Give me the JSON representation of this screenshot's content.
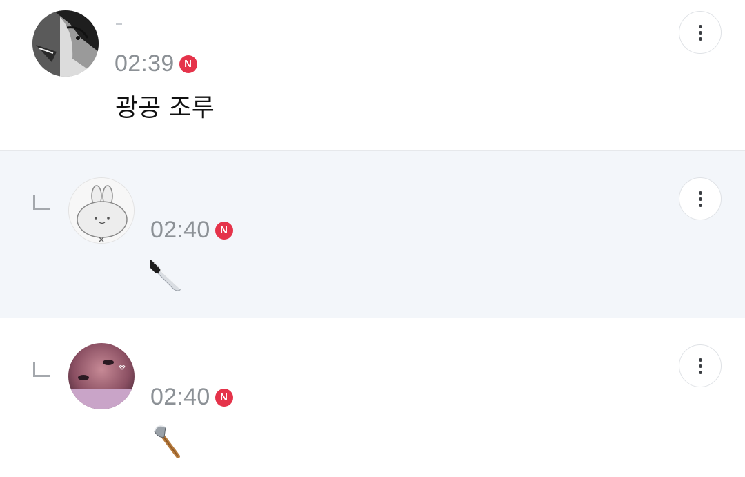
{
  "comments": [
    {
      "author_avatar": "manga-portrait-avatar",
      "time": "02:39",
      "new_badge": "N",
      "body": "광공 조루",
      "is_reply": false
    },
    {
      "author_avatar": "bunny-avatar",
      "time": "02:40",
      "new_badge": "N",
      "body_icon": "kitchen-knife-icon",
      "is_reply": true
    },
    {
      "author_avatar": "pink-photo-avatar",
      "time": "02:40",
      "new_badge": "N",
      "body_icon": "axe-icon",
      "is_reply": true
    }
  ],
  "colors": {
    "reply_highlight_bg": "#f3f6fa",
    "new_badge": "#e5334a",
    "time_text": "#8c9196",
    "divider": "#e6e8eb"
  },
  "icons": {
    "more": "more-vertical-icon",
    "reply": "reply-corner-icon"
  }
}
